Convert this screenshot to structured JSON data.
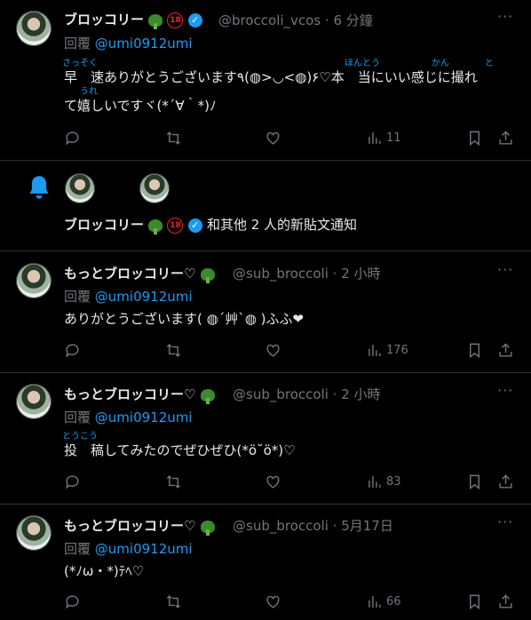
{
  "tweet1": {
    "name": "ブロッコリー",
    "handle": "@broccoli_vcos · 6 分鐘",
    "reply_prefix": "回覆",
    "reply_to": "@umi0912umi",
    "ruby1": "さっそく",
    "ruby2": "ほんとう",
    "ruby3": "かん",
    "ruby4": "と",
    "ruby5": "うれ",
    "line1": "早　速ありがとうございます٩(◍>◡<◍)۶♡本　当にいい感じに撮れ",
    "line2": "て嬉しいですヾ(*´∀｀*)ﾉ",
    "views": "11"
  },
  "notice": {
    "name": "ブロッコリー",
    "text": "和其他 2 人的新貼文通知"
  },
  "tweet2": {
    "name": "もっとブロッコリー♡",
    "handle": "@sub_broccoli · 2 小時",
    "reply_prefix": "回覆",
    "reply_to": "@umi0912umi",
    "line1": "ありがとうございます( ◍´艸`◍ )ふふ❤",
    "views": "176"
  },
  "tweet3": {
    "name": "もっとブロッコリー♡",
    "handle": "@sub_broccoli · 2 小時",
    "reply_prefix": "回覆",
    "reply_to": "@umi0912umi",
    "ruby1": "とうこう",
    "line1": "投　稿してみたのでぜひぜひ(*ӧ˘ӧ*)♡",
    "views": "83"
  },
  "tweet4": {
    "name": "もっとブロッコリー♡",
    "handle": "@sub_broccoli · 5月17日",
    "reply_prefix": "回覆",
    "reply_to": "@umi0912umi",
    "line1": "(*ﾉω・*)ﾃﾍ♡",
    "views": "66"
  },
  "icons": [
    "more-icon",
    "reply-icon",
    "retweet-icon",
    "like-icon",
    "views-icon",
    "bookmark-icon",
    "share-icon",
    "bell-icon",
    "verified-icon",
    "broccoli-emoji"
  ],
  "colors": {
    "accent": "#1d9bf0",
    "muted": "#71767b",
    "text": "#e7e9ea",
    "divider": "#2f3336",
    "adult": "#f4212e"
  }
}
